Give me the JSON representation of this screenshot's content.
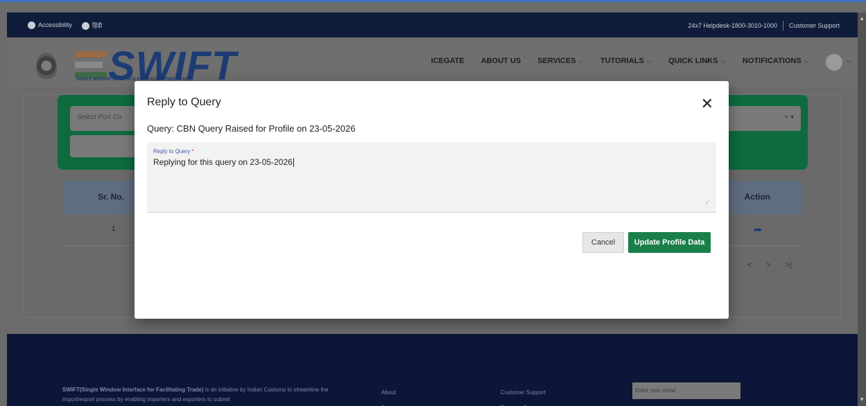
{
  "topbar": {
    "accessibility_label": "Accessibility",
    "language_label": "हिंदी",
    "helpdesk": "24x7 Helpdesk-1800-3010-1000",
    "support": "Customer Support"
  },
  "header": {
    "logo_text": "SWIFT",
    "logo_subtitle": "SINGLE WINDOW INTERFACE FOR FACILITATING TRADE",
    "nav": [
      {
        "label": "ICEGATE",
        "dropdown": false
      },
      {
        "label": "ABOUT US",
        "dropdown": false
      },
      {
        "label": "SERVICES",
        "dropdown": true
      },
      {
        "label": "TUTORIALS",
        "dropdown": true
      },
      {
        "label": "QUICK LINKS",
        "dropdown": true
      },
      {
        "label": "NOTIFICATIONS",
        "dropdown": true
      }
    ]
  },
  "filters": {
    "port_placeholder": "Select Port Co",
    "clear_symbol": "× ▾"
  },
  "table": {
    "headers": {
      "sr": "Sr. No.",
      "action": "Action"
    },
    "rows": [
      {
        "sr": "1"
      }
    ]
  },
  "pager": [
    "<",
    ">",
    ">|"
  ],
  "modal": {
    "title": "Reply to Query",
    "close": "✕",
    "query_prefix": "Query:",
    "query_text": "CBN Query Raised for Profile on 23-05-2026",
    "field_label": "Reply to Query",
    "field_required": "*",
    "field_value": "Replying for this query on 23-05-2026",
    "cancel_label": "Cancel",
    "update_label": "Update Profile Data"
  },
  "footer": {
    "about_bold": "SWIFT(Single Window Interface for Facilitating Trade)",
    "about_rest": " is an initiative by Indian Customs to streamline the import/export process by enabling importers and exporters to submit",
    "col2": [
      "About",
      "Service"
    ],
    "col3": [
      "Customer Support",
      "Tracking Status"
    ],
    "email_placeholder": "Enter your email"
  },
  "colors": {
    "topbar": "#101d3a",
    "primary_green": "#1a7f4a",
    "footer": "#0c1638",
    "label_blue": "#3f51b5"
  }
}
